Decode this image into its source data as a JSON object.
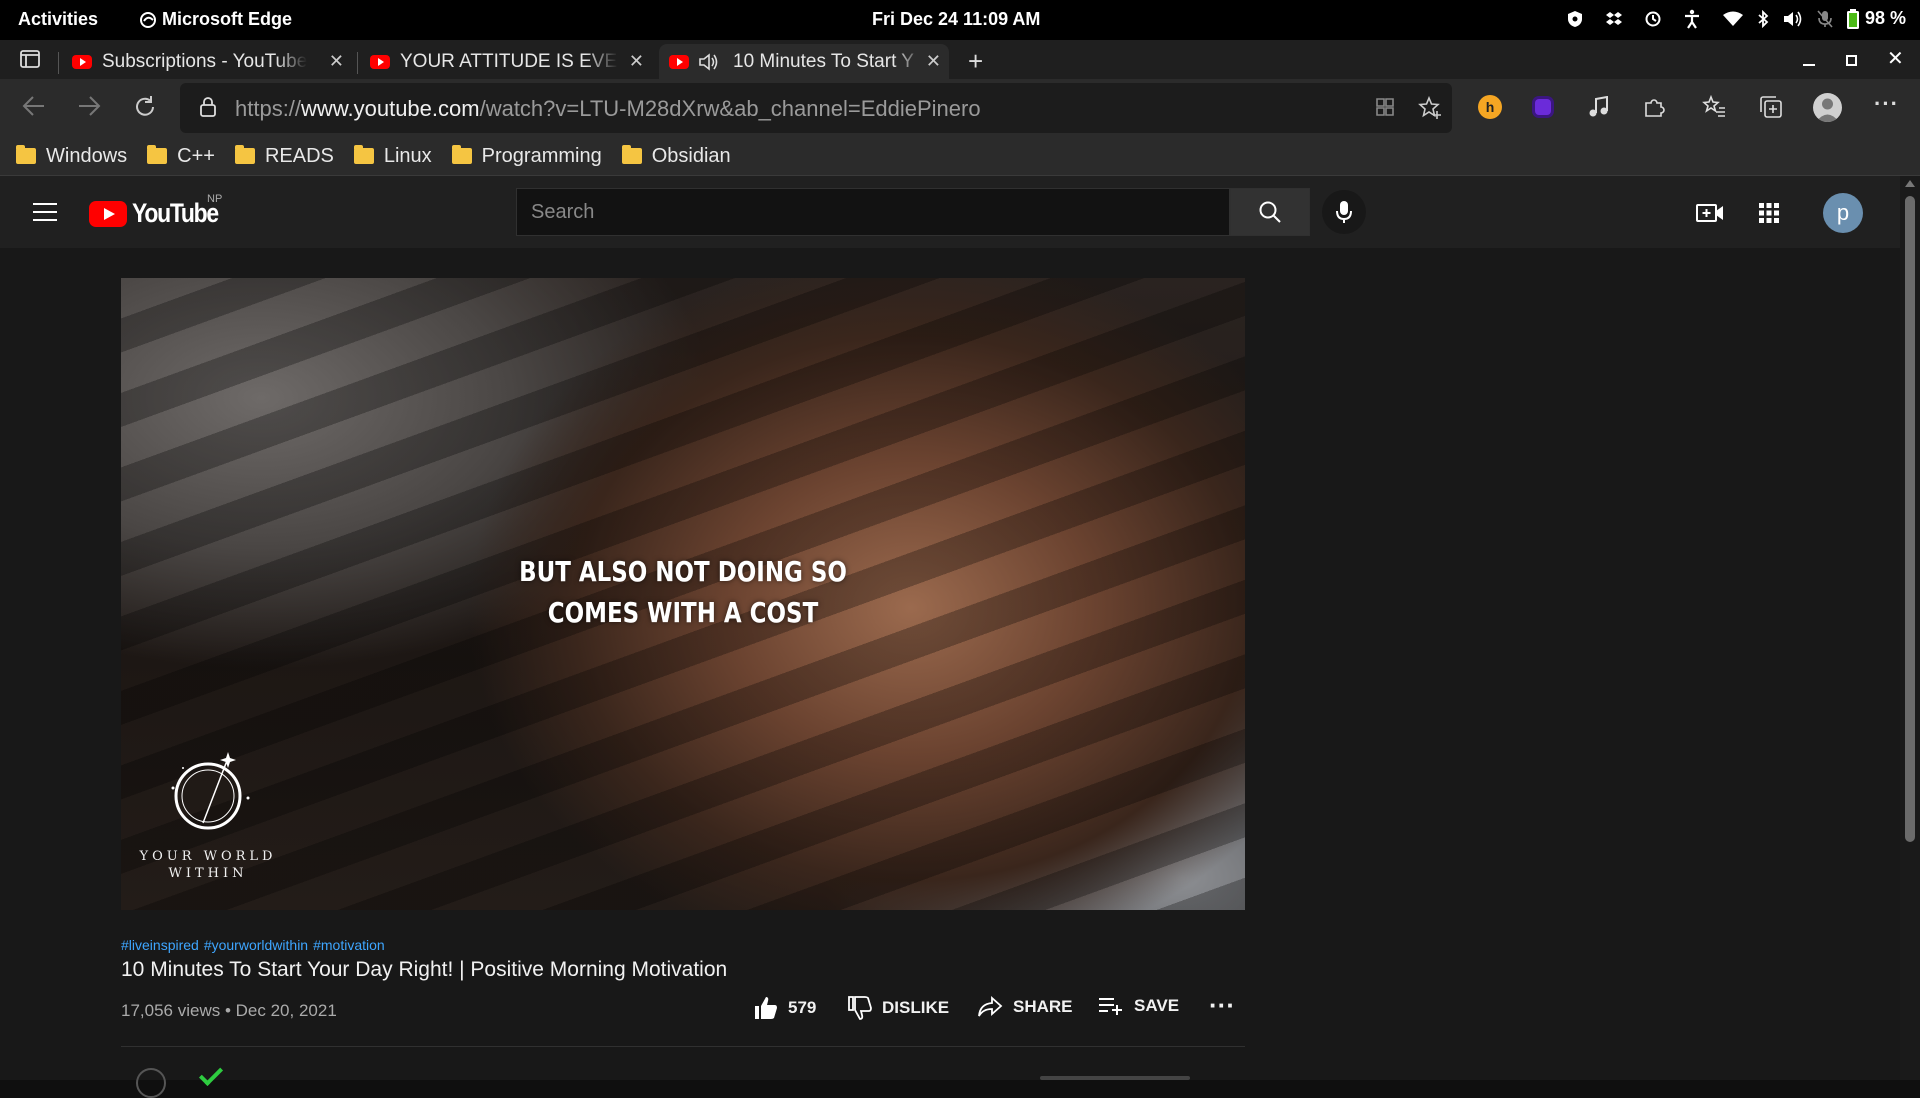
{
  "system": {
    "activities": "Activities",
    "app_name": "Microsoft Edge",
    "clock": "Fri Dec 24  11:09 AM",
    "battery": "98 %"
  },
  "tabs": [
    {
      "title": "Subscriptions - YouTube",
      "active": false
    },
    {
      "title": "YOUR ATTITUDE IS EVER",
      "active": false
    },
    {
      "title": "10 Minutes To Start Y",
      "active": true,
      "audio": true
    }
  ],
  "address": {
    "scheme": "https://",
    "host": "www.youtube.com",
    "path": "/watch?v=LTU-M28dXrw&ab_channel=EddiePinero"
  },
  "bookmarks": [
    "Windows",
    "C++",
    "READS",
    "Linux",
    "Programming",
    "Obsidian"
  ],
  "youtube": {
    "logo_text": "YouTube",
    "region": "NP",
    "search_placeholder": "Search",
    "avatar_letter": "p",
    "video": {
      "caption_line1": "BUT ALSO NOT DOING SO",
      "caption_line2": "COMES WITH A COST",
      "watermark_line1": "YOUR WORLD",
      "watermark_line2": "WITHIN",
      "hashtags": [
        "#liveinspired",
        "#yourworldwithin",
        "#motivation"
      ],
      "title": "10 Minutes To Start Your Day Right! | Positive Morning Motivation",
      "views": "17,056 views",
      "date": "Dec 20, 2021",
      "likes": "579",
      "dislike_label": "DISLIKE",
      "share_label": "SHARE",
      "save_label": "SAVE"
    }
  },
  "colors": {
    "youtube_red": "#ff0000",
    "hashtag_blue": "#3ea6ff",
    "folder_yellow": "#f5c542"
  }
}
